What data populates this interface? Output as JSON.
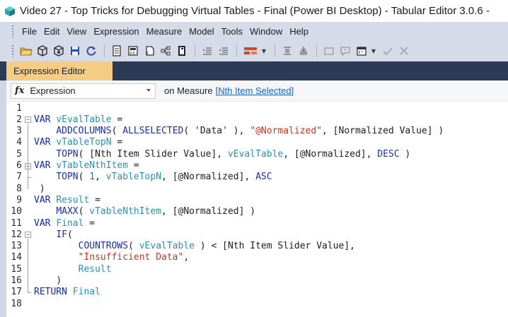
{
  "window": {
    "title": "Video 27 - Top Tricks for Debugging Virtual Tables - Final (Power BI Desktop) - Tabular Editor 3.0.6 -"
  },
  "menu": [
    "File",
    "Edit",
    "View",
    "Expression",
    "Measure",
    "Model",
    "Tools",
    "Window",
    "Help"
  ],
  "toolbar_icons": [
    "open-folder-icon",
    "cube-icon",
    "cube-refresh-icon",
    "save-icon",
    "undo-icon",
    "document-icon",
    "calculator-icon",
    "script-icon",
    "hierarchy-icon",
    "format-icon",
    "indent-icon",
    "outdent-icon",
    "relationship-icon",
    "pin-icon",
    "import-icon",
    "window-icon",
    "comment-icon",
    "calendar-icon",
    "check-icon",
    "close-icon"
  ],
  "tab": {
    "label": "Expression Editor"
  },
  "property_bar": {
    "fx": "fx",
    "selected": "Expression",
    "on_text": "on Measure",
    "measure_link": "[Nth Item Selected]"
  },
  "editor": {
    "line_numbers": [
      "1",
      "2",
      "3",
      "4",
      "5",
      "6",
      "7",
      "8",
      "9",
      "10",
      "11",
      "12",
      "13",
      "14",
      "15",
      "16",
      "17",
      "18"
    ],
    "lines": [
      {
        "indent": 0,
        "tokens": []
      },
      {
        "indent": 0,
        "tokens": [
          [
            "k",
            "VAR"
          ],
          [
            "p",
            " "
          ],
          [
            "v",
            "vEvalTable"
          ],
          [
            "p",
            " ="
          ]
        ]
      },
      {
        "indent": 4,
        "tokens": [
          [
            "f",
            "ADDCOLUMNS"
          ],
          [
            "p",
            "( "
          ],
          [
            "f",
            "ALLSELECTED"
          ],
          [
            "p",
            "( 'Data' ), "
          ],
          [
            "s",
            "\"@Normalized\""
          ],
          [
            "p",
            ", [Normalized Value] )"
          ]
        ]
      },
      {
        "indent": 0,
        "tokens": [
          [
            "k",
            "VAR"
          ],
          [
            "p",
            " "
          ],
          [
            "v",
            "vTableTopN"
          ],
          [
            "p",
            " ="
          ]
        ]
      },
      {
        "indent": 4,
        "tokens": [
          [
            "f",
            "TOPN"
          ],
          [
            "p",
            "( [Nth Item Slider Value], "
          ],
          [
            "v",
            "vEvalTable"
          ],
          [
            "p",
            ", [@Normalized], "
          ],
          [
            "f",
            "DESC"
          ],
          [
            "p",
            " )"
          ]
        ]
      },
      {
        "indent": 0,
        "tokens": [
          [
            "k",
            "VAR"
          ],
          [
            "p",
            " "
          ],
          [
            "v",
            "vTableNthItem"
          ],
          [
            "p",
            " ="
          ]
        ]
      },
      {
        "indent": 4,
        "tokens": [
          [
            "f",
            "TOPN"
          ],
          [
            "p",
            "( "
          ],
          [
            "n",
            "1"
          ],
          [
            "p",
            ", "
          ],
          [
            "v",
            "vTableTopN"
          ],
          [
            "p",
            ", [@Normalized], "
          ],
          [
            "f",
            "ASC"
          ]
        ]
      },
      {
        "indent": 1,
        "tokens": [
          [
            "p",
            ")"
          ]
        ]
      },
      {
        "indent": 0,
        "tokens": [
          [
            "k",
            "VAR"
          ],
          [
            "p",
            " "
          ],
          [
            "v",
            "Result"
          ],
          [
            "p",
            " ="
          ]
        ]
      },
      {
        "indent": 4,
        "tokens": [
          [
            "f",
            "MAXX"
          ],
          [
            "p",
            "( "
          ],
          [
            "v",
            "vTableNthItem"
          ],
          [
            "p",
            ", [@Normalized] )"
          ]
        ]
      },
      {
        "indent": 0,
        "tokens": [
          [
            "k",
            "VAR"
          ],
          [
            "p",
            " "
          ],
          [
            "v",
            "Final"
          ],
          [
            "p",
            " ="
          ]
        ]
      },
      {
        "indent": 4,
        "tokens": [
          [
            "f",
            "IF"
          ],
          [
            "p",
            "("
          ]
        ]
      },
      {
        "indent": 8,
        "tokens": [
          [
            "f",
            "COUNTROWS"
          ],
          [
            "p",
            "( "
          ],
          [
            "v",
            "vEvalTable"
          ],
          [
            "p",
            " ) < [Nth Item Slider Value],"
          ]
        ]
      },
      {
        "indent": 8,
        "tokens": [
          [
            "s",
            "\"Insufficient Data\""
          ],
          [
            "p",
            ","
          ]
        ]
      },
      {
        "indent": 8,
        "tokens": [
          [
            "v",
            "Result"
          ]
        ]
      },
      {
        "indent": 4,
        "tokens": [
          [
            "p",
            ")"
          ]
        ]
      },
      {
        "indent": 0,
        "tokens": [
          [
            "k",
            "RETURN"
          ],
          [
            "p",
            " "
          ],
          [
            "v",
            "Final"
          ]
        ]
      },
      {
        "indent": 0,
        "tokens": []
      }
    ],
    "colors": {
      "keyword": "#0a28b4",
      "function": "#1a2fa8",
      "variable": "#2b91af",
      "string": "#c4361f",
      "number": "#2b7a78"
    }
  }
}
